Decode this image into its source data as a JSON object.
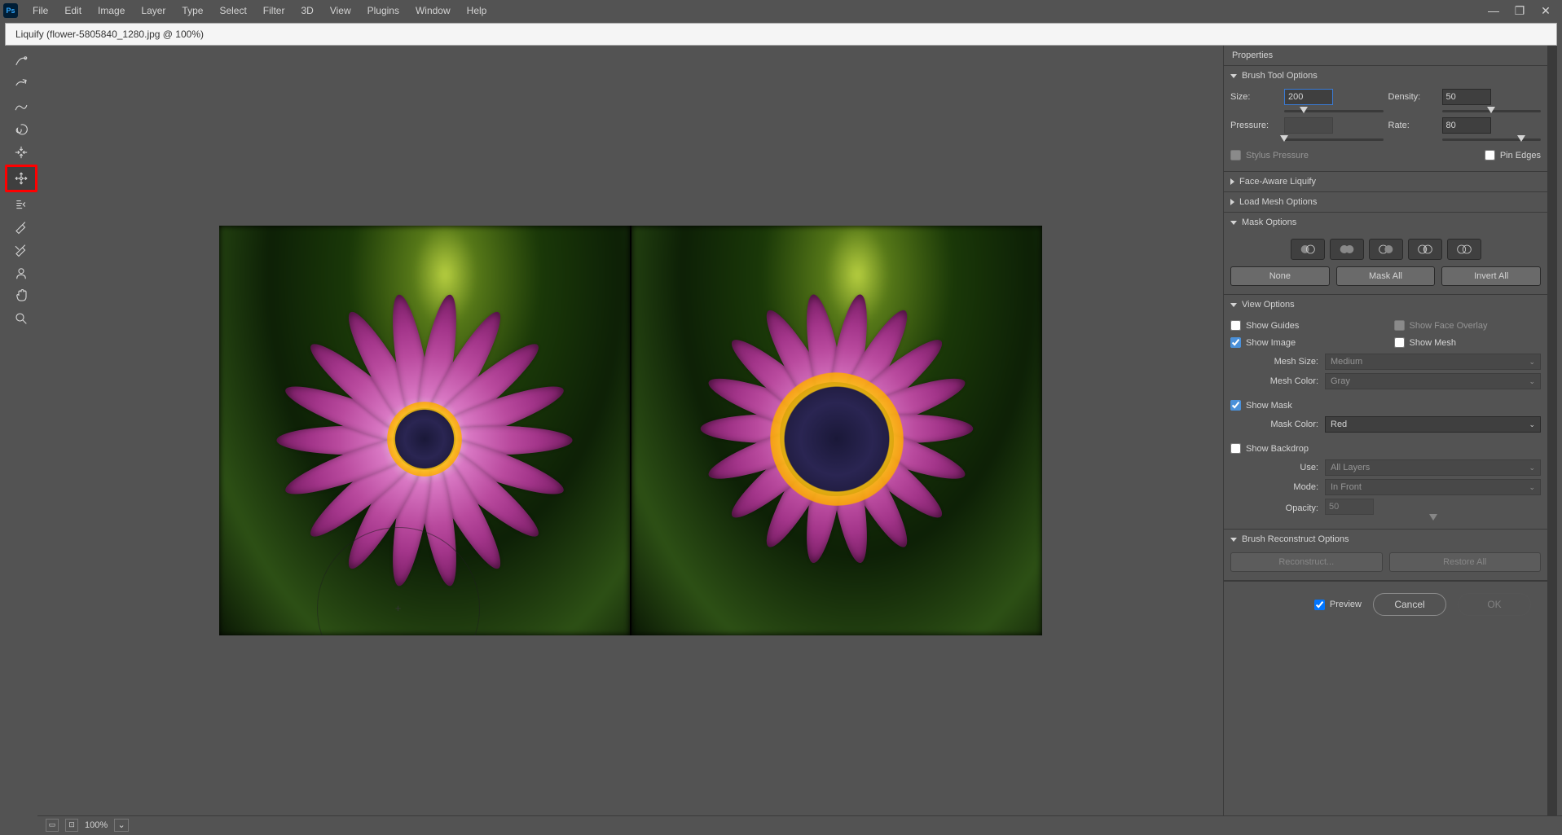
{
  "menu": {
    "items": [
      "File",
      "Edit",
      "Image",
      "Layer",
      "Type",
      "Select",
      "Filter",
      "3D",
      "View",
      "Plugins",
      "Window",
      "Help"
    ]
  },
  "window_controls": {
    "min": "—",
    "max": "❐",
    "close": "✕"
  },
  "document": {
    "title": "Liquify (flower-5805840_1280.jpg @ 100%)"
  },
  "tools": {
    "items": [
      {
        "name": "forward-warp",
        "selected": false
      },
      {
        "name": "reconstruct",
        "selected": false
      },
      {
        "name": "smooth",
        "selected": false
      },
      {
        "name": "twirl",
        "selected": false
      },
      {
        "name": "pucker",
        "selected": false
      },
      {
        "name": "bloat",
        "selected": true
      },
      {
        "name": "push-left",
        "selected": false
      },
      {
        "name": "freeze-mask",
        "selected": false
      },
      {
        "name": "thaw-mask",
        "selected": false
      },
      {
        "name": "face",
        "selected": false
      },
      {
        "name": "hand",
        "selected": false
      },
      {
        "name": "zoom",
        "selected": false
      }
    ]
  },
  "properties": {
    "title": "Properties",
    "brush_tool_options": {
      "title": "Brush Tool Options",
      "size_label": "Size:",
      "size": "200",
      "density_label": "Density:",
      "density": "50",
      "pressure_label": "Pressure:",
      "pressure": "",
      "rate_label": "Rate:",
      "rate": "80",
      "stylus_pressure_label": "Stylus Pressure",
      "stylus_pressure": false,
      "pin_edges_label": "Pin Edges",
      "pin_edges": false
    },
    "face_aware": {
      "title": "Face-Aware Liquify"
    },
    "load_mesh": {
      "title": "Load Mesh Options"
    },
    "mask_options": {
      "title": "Mask Options",
      "none_label": "None",
      "mask_all_label": "Mask All",
      "invert_all_label": "Invert All"
    },
    "view_options": {
      "title": "View Options",
      "show_guides_label": "Show Guides",
      "show_guides": false,
      "show_face_overlay_label": "Show Face Overlay",
      "show_face_overlay": false,
      "show_image_label": "Show Image",
      "show_image": true,
      "show_mesh_label": "Show Mesh",
      "show_mesh": false,
      "mesh_size_label": "Mesh Size:",
      "mesh_size": "Medium",
      "mesh_color_label": "Mesh Color:",
      "mesh_color": "Gray",
      "show_mask_label": "Show Mask",
      "show_mask": true,
      "mask_color_label": "Mask Color:",
      "mask_color": "Red",
      "show_backdrop_label": "Show Backdrop",
      "show_backdrop": false,
      "use_label": "Use:",
      "use": "All Layers",
      "mode_label": "Mode:",
      "mode": "In Front",
      "opacity_label": "Opacity:",
      "opacity": "50"
    },
    "brush_reconstruct": {
      "title": "Brush Reconstruct Options",
      "reconstruct_label": "Reconstruct...",
      "restore_label": "Restore All"
    }
  },
  "footer": {
    "preview_label": "Preview",
    "preview": true,
    "cancel_label": "Cancel",
    "ok_label": "OK"
  },
  "status": {
    "zoom": "100%"
  }
}
